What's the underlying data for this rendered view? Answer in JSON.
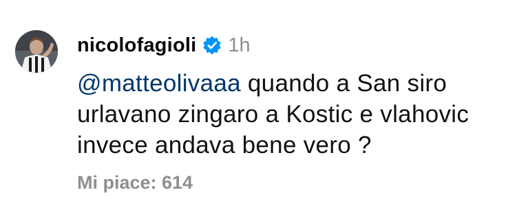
{
  "comment": {
    "username": "nicolofagioli",
    "verified_icon": "verified-badge-icon",
    "time": "1h",
    "mention": "@matteolivaaa",
    "line1_rest": " quando a San siro",
    "line2": "urlavano zingaro a Kostic e vlahovic",
    "line3": "invece andava bene vero ?",
    "likes": "Mi piace: 614"
  },
  "colors": {
    "mention": "#00376b",
    "verified": "#0095f6",
    "muted": "#8e8e8e"
  }
}
